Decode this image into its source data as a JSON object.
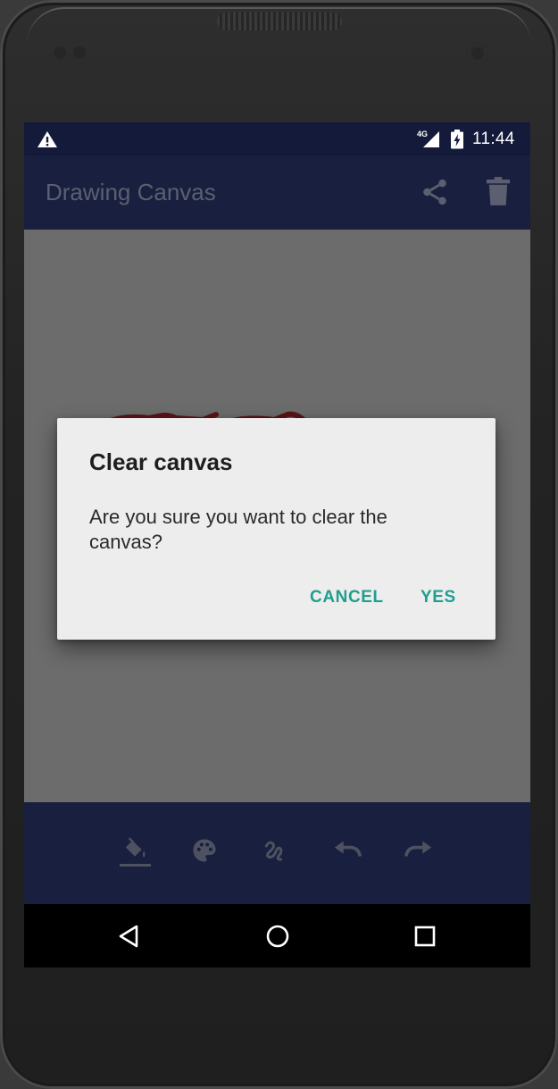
{
  "status_bar": {
    "network_label": "4G",
    "time": "11:44",
    "icons": [
      "warning-icon",
      "signal-icon",
      "battery-charging-icon"
    ]
  },
  "app_bar": {
    "title": "Drawing Canvas",
    "actions": [
      "share-icon",
      "delete-icon"
    ]
  },
  "dialog": {
    "title": "Clear canvas",
    "message": "Are you sure you want to clear the canvas?",
    "cancel_label": "CANCEL",
    "confirm_label": "YES"
  },
  "toolbar": {
    "tools": [
      "fill-bucket-icon",
      "palette-icon",
      "brush-stroke-icon",
      "undo-icon",
      "redo-icon"
    ],
    "selected_tool": "fill-bucket-icon"
  },
  "nav_bar": {
    "buttons": [
      "back-icon",
      "home-icon",
      "recents-icon"
    ]
  },
  "colors": {
    "status_bar": "#131a3a",
    "app_bar": "#19203f",
    "canvas_scrim": "#6c6c6c",
    "dialog_background": "#ededed",
    "dialog_button": "#1f9f8f",
    "stroke": "#7a0f14"
  }
}
